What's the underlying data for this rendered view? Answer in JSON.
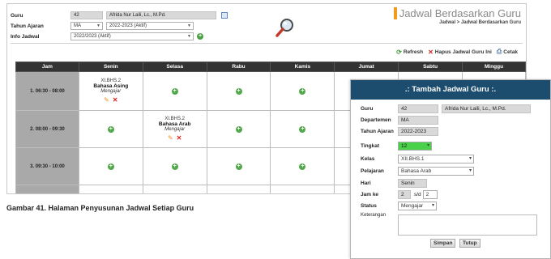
{
  "filters": {
    "guru_label": "Guru",
    "guru_code": "42",
    "guru_name": "Afrida Nur Laili, Lc., M.Pd.",
    "tahun_label": "Tahun Ajaran",
    "tahun_dept": "MA",
    "tahun_value": "2022-2023 (Aktif)",
    "info_label": "Info Jadwal",
    "info_value": "2022/2023 (Aktif)"
  },
  "header": {
    "title": "Jadwal Berdasarkan Guru",
    "breadcrumb": "Jadwal > Jadwal Berdasarkan Guru"
  },
  "actions": {
    "refresh": "Refresh",
    "hapus": "Hapus Jadwal Guru Ini",
    "cetak": "Cetak"
  },
  "schedule": {
    "columns": [
      "Jam",
      "Senin",
      "Selasa",
      "Rabu",
      "Kamis",
      "Jumat",
      "Sabtu",
      "Minggu"
    ],
    "rows": [
      {
        "num": "1.",
        "time": "06:30 - 08:00"
      },
      {
        "num": "2.",
        "time": "08:00 - 09:30"
      },
      {
        "num": "3.",
        "time": "09:30 - 10:00"
      }
    ],
    "slots": {
      "r1_senin": {
        "kelas": "XI.BHS.2",
        "mapel": "Bahasa Asing",
        "status": "Mengajar"
      },
      "r2_selasa": {
        "kelas": "XI.BHS.2",
        "mapel": "Bahasa Arab",
        "status": "Mengajar"
      }
    }
  },
  "caption": "Gambar 41. Halaman Penyusunan Jadwal Setiap Guru",
  "modal": {
    "title": ".: Tambah Jadwal Guru :.",
    "guru_label": "Guru",
    "guru_code": "42",
    "guru_name": "Afrida Nur Laili, Lc., M.Pd.",
    "dept_label": "Departemen",
    "dept_value": "MA",
    "tahun_label": "Tahun Ajaran",
    "tahun_value": "2022-2023",
    "tingkat_label": "Tingkat",
    "tingkat_value": "12",
    "kelas_label": "Kelas",
    "kelas_value": "XII.BHS.1",
    "pelajaran_label": "Pelajaran",
    "pelajaran_value": "Bahasa Arab",
    "hari_label": "Hari",
    "hari_value": "Senin",
    "jam_label": "Jam ke",
    "jam_from": "2",
    "jam_sep": "s/d",
    "jam_to": "2",
    "status_label": "Status",
    "status_value": "Mengajar",
    "keterangan_label": "Keterangan",
    "simpan": "Simpan",
    "tutup": "Tutup"
  },
  "colors": {
    "table_header": "#333333",
    "modal_header": "#1c4c6e",
    "plus_green": "#49a243",
    "title_accent": "#f29a1f"
  }
}
